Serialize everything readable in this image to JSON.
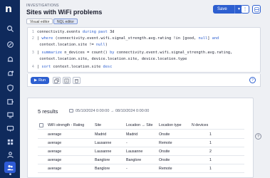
{
  "nav": {
    "logo": "n",
    "items": [
      {
        "icon": "search-icon"
      },
      {
        "icon": "rocket-icon"
      },
      {
        "icon": "bell-icon"
      },
      {
        "icon": "bell-alert-icon"
      },
      {
        "icon": "shield-icon"
      },
      {
        "icon": "puzzle-icon"
      },
      {
        "icon": "monitor-icon"
      },
      {
        "icon": "desktop-icon"
      },
      {
        "icon": "grid-icon"
      },
      {
        "icon": "users-icon"
      },
      {
        "icon": "people-icon"
      },
      {
        "icon": "network-icon"
      }
    ]
  },
  "header": {
    "overline": "INVESTIGATIONS",
    "title": "Sites with WiFi problems",
    "save_label": "Save",
    "more_icon": "more-vertical-icon",
    "collapse_icon": "collapse-icon"
  },
  "tabs": [
    {
      "label": "Visual editor",
      "selected": false
    },
    {
      "label": "NQL editor",
      "selected": true
    }
  ],
  "editor": {
    "lines": [
      {
        "n": "1",
        "text": "connectivity.events during past 3d"
      },
      {
        "n": "2",
        "text": "| where (connectivity.event.wifi.signal_strength.avg.rating !in [good, null] and"
      },
      {
        "n": "",
        "text": "      context.location.site != null)"
      },
      {
        "n": "3",
        "text": "| summarize n_devices = count() by connectivity.event.wifi.signal_strength.avg.rating,"
      },
      {
        "n": "",
        "text": "      context.location.site, device.location.site, device.location.type"
      },
      {
        "n": "4",
        "text": "| sort context.location.site desc"
      }
    ]
  },
  "run": {
    "label": "Run"
  },
  "results": {
    "count": "5 results",
    "range": "05/10/2024 0:00:00 → 08/10/2024 0:00:00",
    "columns": [
      "WiFi strength - Rating",
      "Site",
      "Location → Site",
      "Location type",
      "N devices"
    ],
    "rows": [
      [
        "average",
        "Madrid",
        "Madrid",
        "Onsite",
        "1"
      ],
      [
        "average",
        "Lausanne",
        "-",
        "Remote",
        "1"
      ],
      [
        "average",
        "Lausanne",
        "Lausanne",
        "Onsite",
        "2"
      ],
      [
        "average",
        "Banglore",
        "Banglore",
        "Onsite",
        "1"
      ],
      [
        "average",
        "Banglore",
        "-",
        "Remote",
        "1"
      ]
    ]
  },
  "colors": {
    "accent": "#2d5fd0",
    "nav": "#0f2a5c"
  }
}
